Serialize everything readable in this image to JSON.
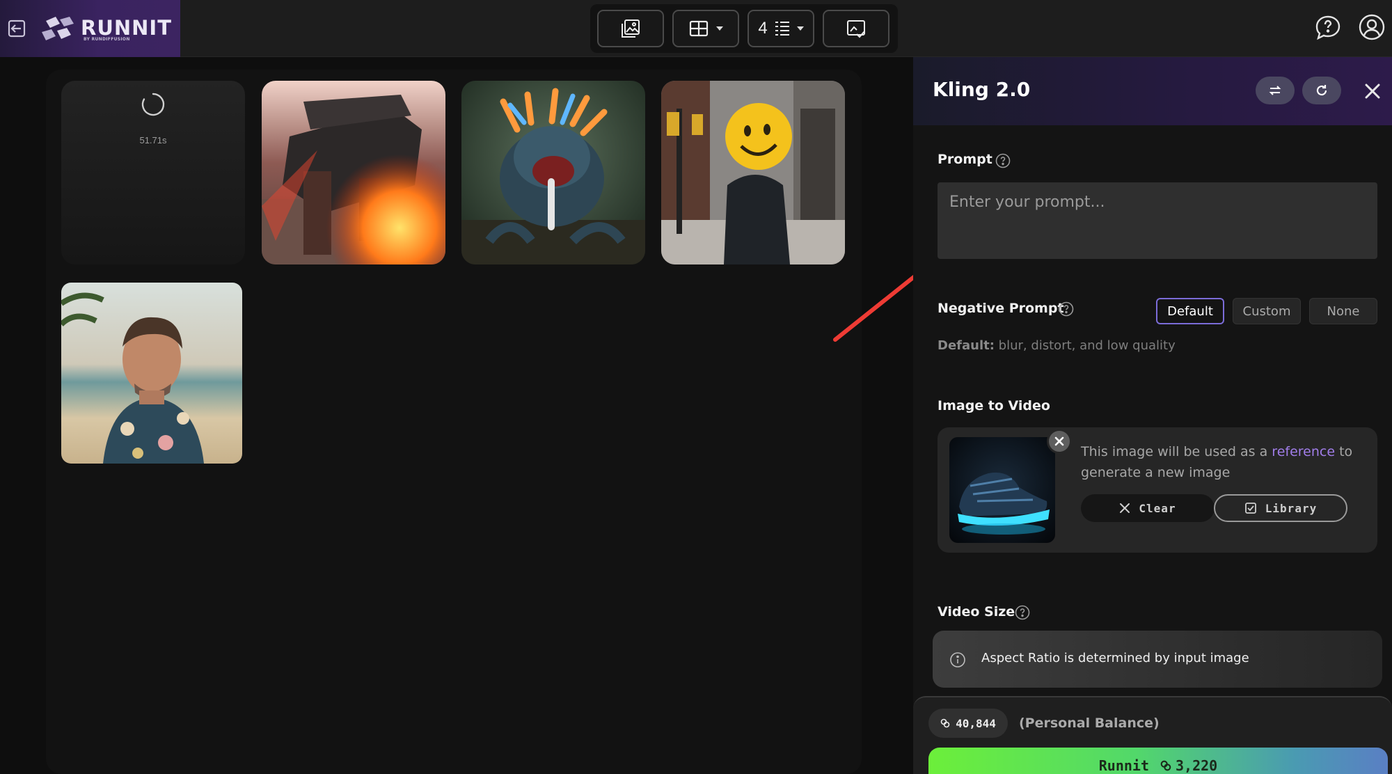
{
  "brand": {
    "name": "RUNNIT",
    "sub": "BY RUNDIFFUSION"
  },
  "toolbar": {
    "columns_value": "4"
  },
  "gallery": {
    "loading_timer": "51.71s"
  },
  "panel": {
    "title": "Kling 2.0",
    "prompt": {
      "label": "Prompt",
      "placeholder": "Enter your prompt..."
    },
    "negative": {
      "label": "Negative Prompt",
      "options": [
        "Default",
        "Custom",
        "None"
      ],
      "selected": "Default",
      "note_prefix": "Default:",
      "note_text": " blur, distort, and low quality"
    },
    "image_to_video": {
      "label": "Image to Video",
      "desc_before": "This image will be used as a ",
      "desc_link": "reference",
      "desc_after": " to generate a new image",
      "clear_label": "Clear",
      "library_label": "Library"
    },
    "video_size": {
      "label": "Video Size",
      "info": "Aspect Ratio is determined by input image"
    },
    "footer": {
      "balance": "40,844",
      "balance_label": "(Personal Balance)",
      "run_label": "Runnit",
      "run_cost": "3,220"
    }
  },
  "colors": {
    "accent": "#7b6cd8",
    "link": "#a07de8",
    "arrow": "#ee3b34",
    "run_start": "#6cef3a",
    "run_end": "#5a7fc4"
  }
}
